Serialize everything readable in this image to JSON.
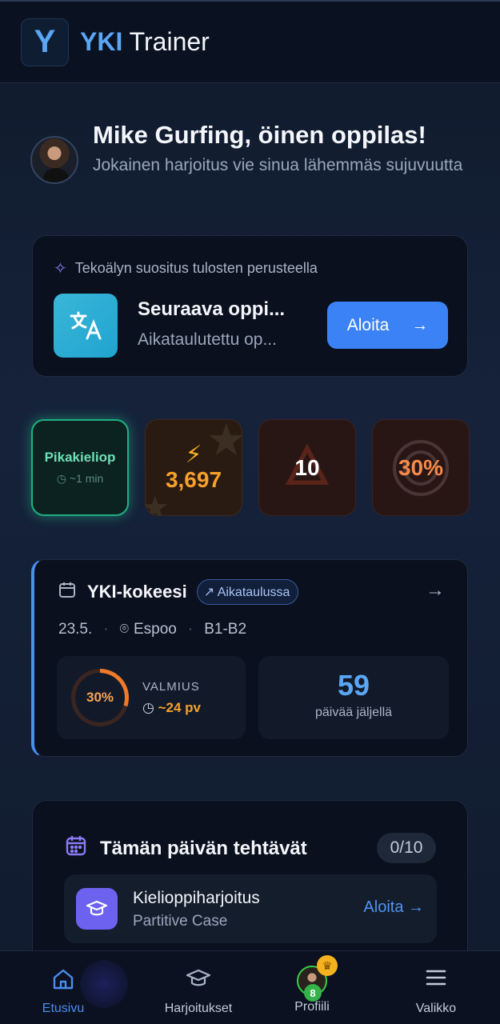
{
  "header": {
    "logo_letter": "Y",
    "title_highlight": "YKI",
    "title_rest": " Trainer"
  },
  "greeting": {
    "title": "Mike Gurfing, öinen oppilas!",
    "subtitle": "Jokainen harjoitus vie sinua lähemmäs sujuvuutta"
  },
  "ai_card": {
    "heading": "Tekoälyn suositus tulosten perusteella",
    "title": "Seuraava oppi...",
    "subtitle": "Aikataulutettu op...",
    "button_label": "Aloita",
    "icon": "translate-icon"
  },
  "stats": {
    "quick": {
      "title": "Pikakieliop",
      "time": "~1 min"
    },
    "xp": {
      "value": "3,697"
    },
    "streak": {
      "value": "10"
    },
    "accuracy": {
      "value": "30%"
    }
  },
  "exam": {
    "title": "YKI-kokeesi",
    "badge": "Aikataulussa",
    "date": "23.5.",
    "location": "Espoo",
    "level": "B1-B2",
    "readiness_percent": 30,
    "readiness_label": "30%",
    "readiness_caption": "VALMIUS",
    "readiness_time": "~24 pv",
    "days_left": "59",
    "days_caption": "päivää jäljellä"
  },
  "tasks": {
    "title": "Tämän päivän tehtävät",
    "count": "0/10",
    "items": [
      {
        "title": "Kielioppiharjoitus",
        "subtitle": "Partitive Case",
        "action": "Aloita"
      }
    ]
  },
  "nav": {
    "home": "Etusivu",
    "exercises": "Harjoitukset",
    "profile": "Profiili",
    "menu": "Valikko",
    "profile_level": "8"
  },
  "colors": {
    "accent": "#3b82f6",
    "orange": "#f6a12a",
    "green": "#1fae80",
    "purple": "#6d62f0"
  }
}
